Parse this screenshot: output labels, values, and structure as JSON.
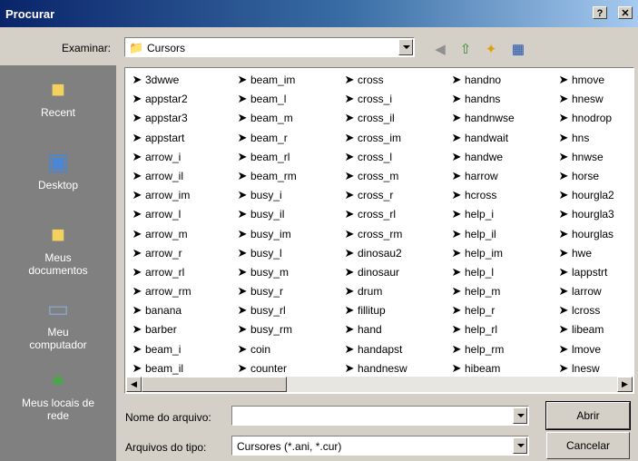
{
  "window": {
    "title": "Procurar",
    "help_label": "?",
    "close_label": "✕"
  },
  "toolbar": {
    "look_in_label": "Examinar:",
    "look_in_value": "Cursors",
    "icons": [
      "back-icon",
      "up-folder-icon",
      "new-folder-icon",
      "view-menu-icon"
    ]
  },
  "places": [
    {
      "label": "Recent",
      "icon": "recent-icon"
    },
    {
      "label": "Desktop",
      "icon": "desktop-icon"
    },
    {
      "label": "Meus documentos",
      "icon": "my-documents-icon"
    },
    {
      "label": "Meu computador",
      "icon": "my-computer-icon"
    },
    {
      "label": "Meus locais de rede",
      "icon": "network-places-icon"
    }
  ],
  "files": {
    "col1": [
      "3dwwe",
      "appstar2",
      "appstar3",
      "appstart",
      "arrow_i",
      "arrow_il",
      "arrow_im",
      "arrow_l",
      "arrow_m",
      "arrow_r",
      "arrow_rl",
      "arrow_rm",
      "banana",
      "barber",
      "beam_i",
      "beam_il"
    ],
    "col2": [
      "beam_im",
      "beam_l",
      "beam_m",
      "beam_r",
      "beam_rl",
      "beam_rm",
      "busy_i",
      "busy_il",
      "busy_im",
      "busy_l",
      "busy_m",
      "busy_r",
      "busy_rl",
      "busy_rm",
      "coin",
      "counter"
    ],
    "col3": [
      "cross",
      "cross_i",
      "cross_il",
      "cross_im",
      "cross_l",
      "cross_m",
      "cross_r",
      "cross_rl",
      "cross_rm",
      "dinosau2",
      "dinosaur",
      "drum",
      "fillitup",
      "hand",
      "handapst",
      "handnesw"
    ],
    "col4": [
      "handno",
      "handns",
      "handnwse",
      "handwait",
      "handwe",
      "harrow",
      "hcross",
      "help_i",
      "help_il",
      "help_im",
      "help_l",
      "help_m",
      "help_r",
      "help_rl",
      "help_rm",
      "hibeam"
    ],
    "col5": [
      "hmove",
      "hnesw",
      "hnodrop",
      "hns",
      "hnwse",
      "horse",
      "hourgla2",
      "hourgla3",
      "hourglas",
      "hwe",
      "lappstrt",
      "larrow",
      "lcross",
      "libeam",
      "lmove",
      "lnesw"
    ]
  },
  "bottom": {
    "filename_label": "Nome do arquivo:",
    "filename_value": "",
    "filetype_label": "Arquivos do tipo:",
    "filetype_value": "Cursores (*.ani, *.cur)",
    "open_label": "Abrir",
    "cancel_label": "Cancelar"
  }
}
